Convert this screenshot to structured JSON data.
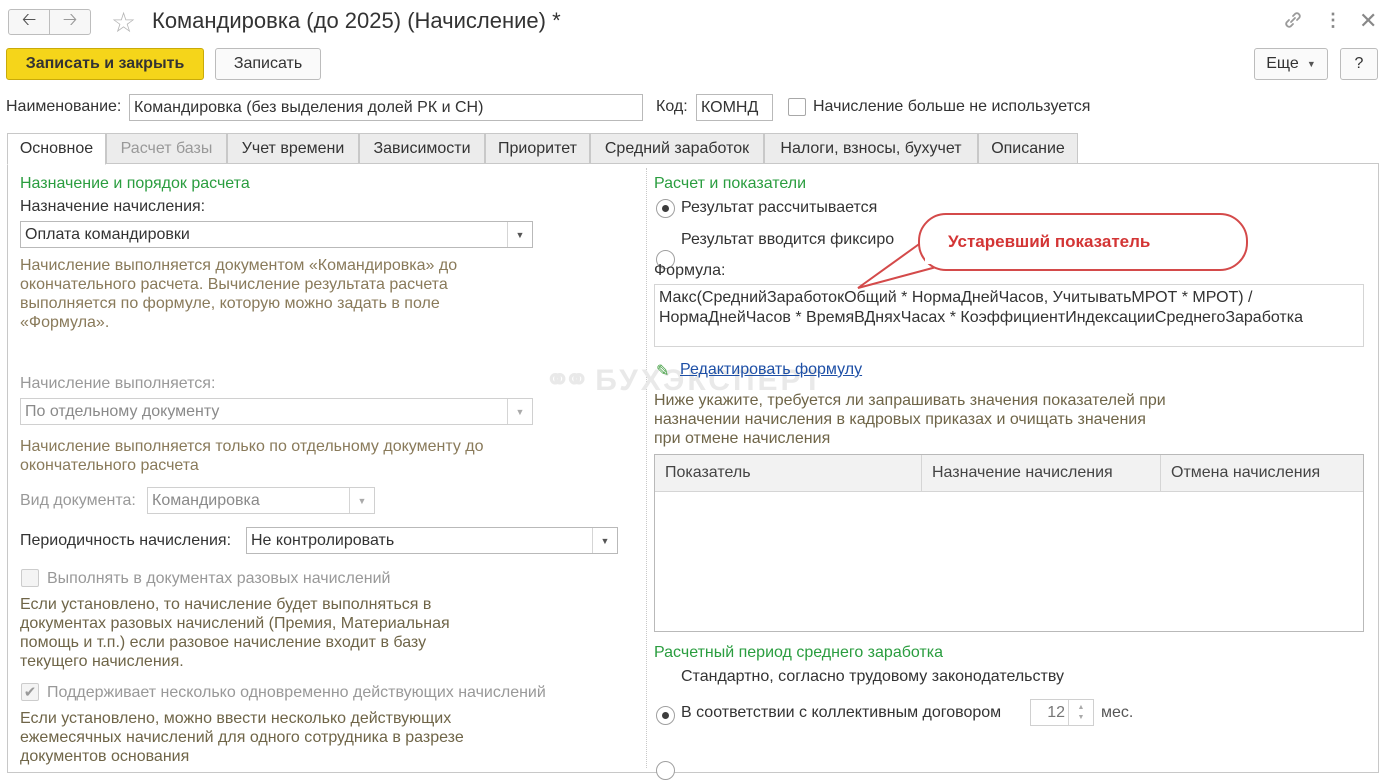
{
  "window": {
    "title": "Командировка (до 2025) (Начисление) *"
  },
  "toolbar": {
    "save_close_label": "Записать и закрыть",
    "save_label": "Записать",
    "more_label": "Еще",
    "help_label": "?"
  },
  "header": {
    "name_label": "Наименование:",
    "name_value": "Командировка (без выделения долей РК и СН)",
    "code_label": "Код:",
    "code_value": "КОМНД",
    "unused_label": "Начисление больше не используется"
  },
  "tabs": [
    {
      "label": "Основное"
    },
    {
      "label": "Расчет базы"
    },
    {
      "label": "Учет времени"
    },
    {
      "label": "Зависимости"
    },
    {
      "label": "Приоритет"
    },
    {
      "label": "Средний заработок"
    },
    {
      "label": "Налоги, взносы, бухучет"
    },
    {
      "label": "Описание"
    }
  ],
  "left": {
    "section_title": "Назначение и порядок расчета",
    "purpose_label": "Назначение начисления:",
    "purpose_value": "Оплата командировки",
    "purpose_hint": "Начисление выполняется документом «Командировка» до окончательного расчета. Вычисление результата расчета выполняется по формуле, которую можно задать в поле «Формула».",
    "performed_label": "Начисление выполняется:",
    "performed_value": "По отдельному документу",
    "performed_hint": "Начисление выполняется только по отдельному документу до окончательного расчета",
    "doc_type_label": "Вид документа:",
    "doc_type_value": "Командировка",
    "periodicity_label": "Периодичность начисления:",
    "periodicity_value": "Не контролировать",
    "onetime_label": "Выполнять в документах разовых начислений",
    "onetime_hint": "Если установлено, то начисление будет выполняться в документах разовых начислений (Премия, Материальная помощь и т.п.) если разовое начисление входит в базу текущего начисления.",
    "multi_label": "Поддерживает несколько одновременно действующих начислений",
    "multi_hint": "Если установлено, можно ввести несколько действующих ежемесячных начислений для одного сотрудника в разрезе документов основания"
  },
  "right": {
    "section_title": "Расчет и показатели",
    "radio_calculated": "Результат рассчитывается",
    "radio_fixed": "Результат вводится фиксиро",
    "formula_label": "Формула:",
    "formula_text": "Макс(СреднийЗаработокОбщий * НормаДнейЧасов, УчитыватьМРОТ * МРОТ) / НормаДнейЧасов * ВремяВДняхЧасах * КоэффициентИндексацииСреднегоЗаработка",
    "edit_formula_link": "Редактировать формулу",
    "indicators_hint": "Ниже укажите, требуется ли запрашивать значения показателей при назначении начисления в кадровых приказах и очищать значения при отмене начисления",
    "table_headers": [
      "Показатель",
      "Назначение начисления",
      "Отмена начисления"
    ],
    "avg_section_title": "Расчетный период среднего заработка",
    "radio_standard": "Стандартно, согласно трудовому законодательству",
    "radio_collective": "В соответствии с коллективным договором",
    "months_value": "12",
    "months_unit": "мес."
  },
  "callout": {
    "text": "Устаревший показатель"
  },
  "watermark": {
    "text": "БУХЭКСПЕРТ"
  }
}
